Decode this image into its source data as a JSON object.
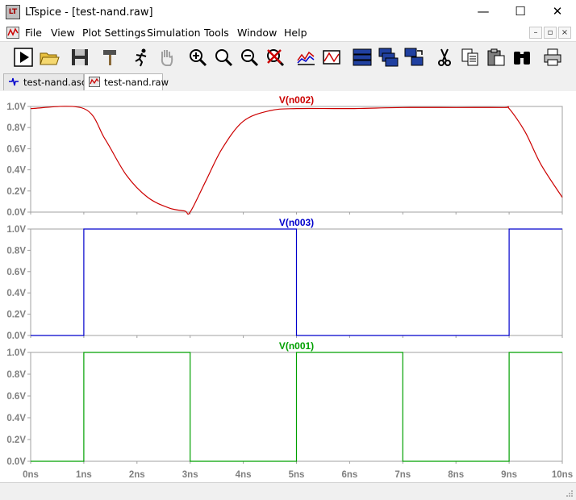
{
  "window": {
    "title": "LTspice - [test-nand.raw]",
    "app_icon_text": "LT",
    "controls": {
      "minimize": "—",
      "maximize": "☐",
      "close": "✕"
    }
  },
  "menu": {
    "items": [
      "File",
      "View",
      "Plot Settings",
      "Simulation",
      "Tools",
      "Window",
      "Help"
    ],
    "mdi_controls": [
      "–",
      "▫",
      "×"
    ]
  },
  "toolbar": {
    "buttons": [
      {
        "name": "run-button",
        "icon": "play-icon"
      },
      {
        "name": "open-button",
        "icon": "folder-open-icon"
      },
      {
        "name": "save-button",
        "icon": "floppy-disk-icon"
      },
      {
        "name": "control-panel-button",
        "icon": "hammer-icon"
      },
      {
        "name": "halt-button",
        "icon": "running-man-icon"
      },
      {
        "name": "pan-button",
        "icon": "hand-icon"
      },
      {
        "name": "zoom-area-button",
        "icon": "zoom-in-icon"
      },
      {
        "name": "zoom-back-button",
        "icon": "zoom-icon"
      },
      {
        "name": "zoom-out-button",
        "icon": "zoom-out-icon"
      },
      {
        "name": "zoom-cancel-button",
        "icon": "zoom-cancel-icon"
      },
      {
        "name": "autorange-button",
        "icon": "autorange-icon"
      },
      {
        "name": "fft-button",
        "icon": "fft-icon"
      },
      {
        "name": "tile-horizontal-button",
        "icon": "tile-horizontal-icon"
      },
      {
        "name": "cascade-button",
        "icon": "cascade-windows-icon"
      },
      {
        "name": "tile-vertical-button",
        "icon": "tile-vertical-icon"
      },
      {
        "name": "cut-button",
        "icon": "scissors-icon"
      },
      {
        "name": "copy-button",
        "icon": "copy-icon"
      },
      {
        "name": "paste-button",
        "icon": "clipboard-icon"
      },
      {
        "name": "find-button",
        "icon": "binoculars-icon"
      },
      {
        "name": "print-button",
        "icon": "printer-icon"
      }
    ]
  },
  "tabs": [
    {
      "label": "test-nand.asc",
      "icon": "schematic-icon",
      "active": false
    },
    {
      "label": "test-nand.raw",
      "icon": "waveform-icon",
      "active": true
    }
  ],
  "colors": {
    "n002": "#cc0000",
    "n003": "#0000cc",
    "n001": "#00a000",
    "axis_text": "#808080",
    "grid": "#a0a0a0"
  },
  "chart_data": [
    {
      "type": "line",
      "title": "V(n002)",
      "xlabel": "",
      "ylabel": "",
      "xlim": [
        0,
        10
      ],
      "ylim": [
        0.0,
        1.0
      ],
      "grid": false,
      "y_ticks": [
        "1.0V",
        "0.8V",
        "0.6V",
        "0.4V",
        "0.2V",
        "0.0V"
      ],
      "series": [
        {
          "name": "V(n002)",
          "x": [
            0,
            1.0,
            1.4,
            1.8,
            2.2,
            2.6,
            2.9,
            3.0,
            3.3,
            3.6,
            4.0,
            4.5,
            5.0,
            6.0,
            7.0,
            8.0,
            8.9,
            9.0,
            9.3,
            9.6,
            10.0
          ],
          "y": [
            0.98,
            0.98,
            0.69,
            0.35,
            0.14,
            0.04,
            0.01,
            0.0,
            0.3,
            0.6,
            0.86,
            0.96,
            0.98,
            0.98,
            0.99,
            0.99,
            0.99,
            0.98,
            0.76,
            0.45,
            0.14
          ]
        }
      ]
    },
    {
      "type": "line",
      "title": "V(n003)",
      "xlabel": "",
      "ylabel": "",
      "xlim": [
        0,
        10
      ],
      "ylim": [
        0.0,
        1.0
      ],
      "grid": false,
      "y_ticks": [
        "1.0V",
        "0.8V",
        "0.6V",
        "0.4V",
        "0.2V",
        "0.0V"
      ],
      "series": [
        {
          "name": "V(n003)",
          "x": [
            0,
            1.0,
            1.0,
            5.0,
            5.0,
            9.0,
            9.0,
            10.0
          ],
          "y": [
            0.0,
            0.0,
            1.0,
            1.0,
            0.0,
            0.0,
            1.0,
            1.0
          ]
        }
      ]
    },
    {
      "type": "line",
      "title": "V(n001)",
      "xlabel": "",
      "ylabel": "",
      "xlim": [
        0,
        10
      ],
      "ylim": [
        0.0,
        1.0
      ],
      "grid": false,
      "y_ticks": [
        "1.0V",
        "0.8V",
        "0.6V",
        "0.4V",
        "0.2V",
        "0.0V"
      ],
      "x_ticks": [
        "0ns",
        "1ns",
        "2ns",
        "3ns",
        "4ns",
        "5ns",
        "6ns",
        "7ns",
        "8ns",
        "9ns",
        "10ns"
      ],
      "series": [
        {
          "name": "V(n001)",
          "x": [
            0,
            1.0,
            1.0,
            3.0,
            3.0,
            5.0,
            5.0,
            7.0,
            7.0,
            9.0,
            9.0,
            10.0
          ],
          "y": [
            0.0,
            0.0,
            1.0,
            1.0,
            0.0,
            0.0,
            1.0,
            1.0,
            0.0,
            0.0,
            1.0,
            1.0
          ]
        }
      ]
    }
  ]
}
